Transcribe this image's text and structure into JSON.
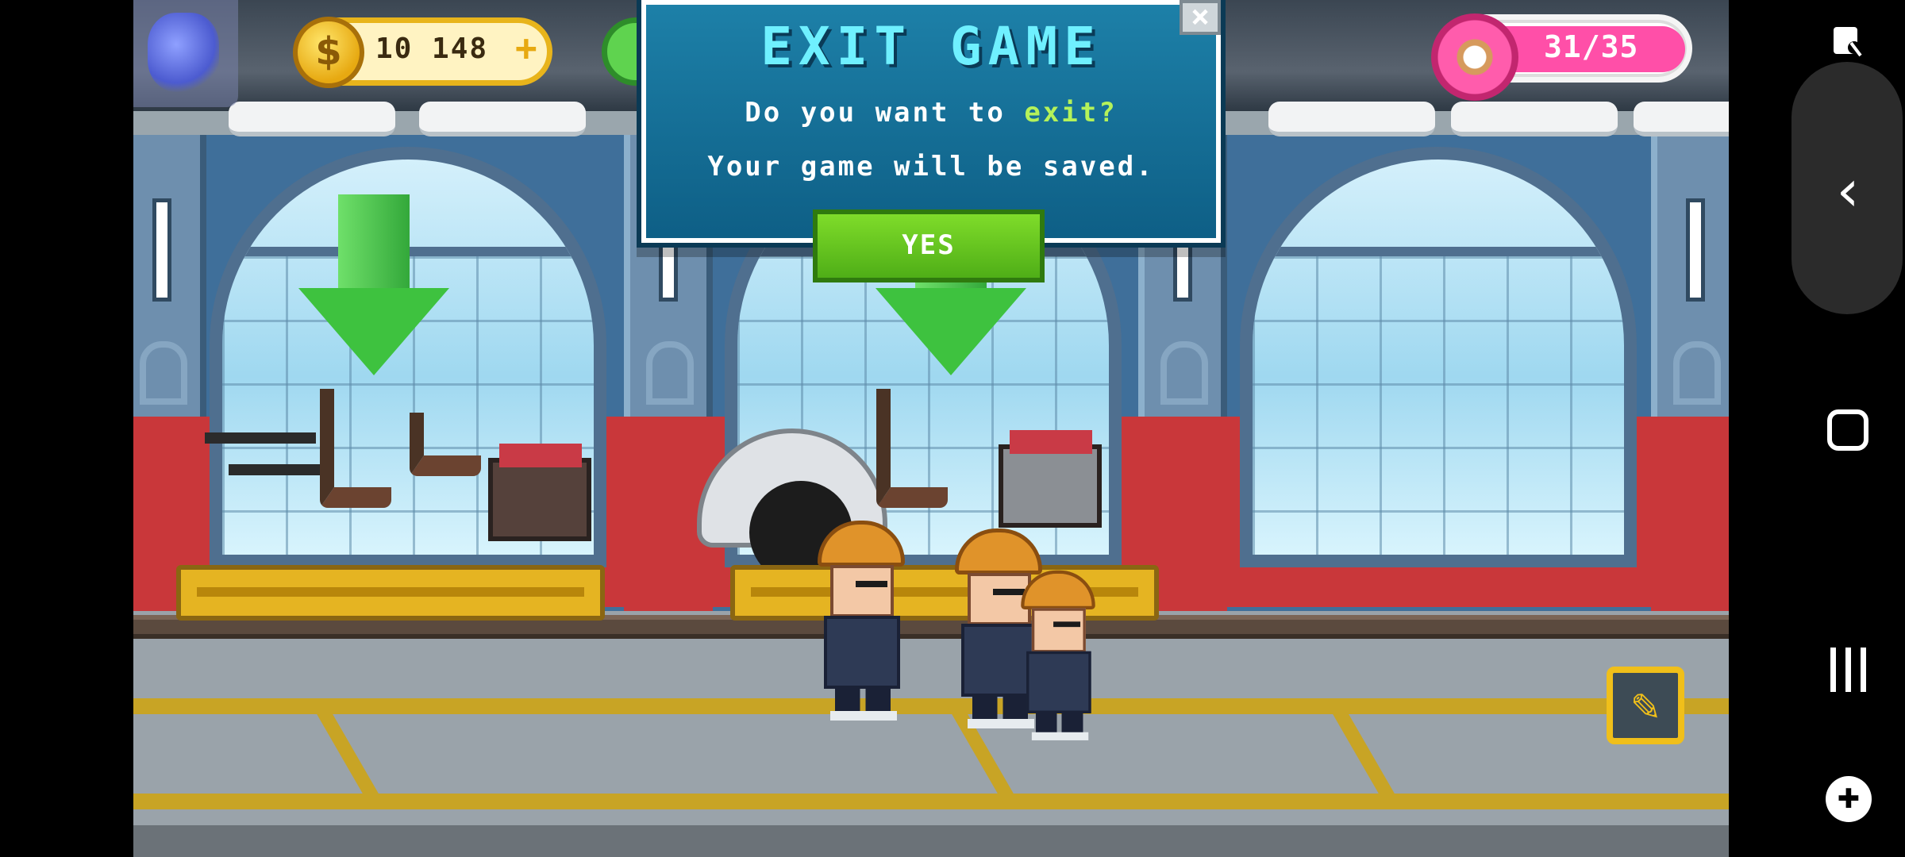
{
  "hud": {
    "coins": {
      "icon": "dollar-coin-icon",
      "symbol": "$",
      "value": "10 148",
      "add": "+"
    },
    "donuts": {
      "icon": "donut-icon",
      "value": "31/35",
      "fill_fraction": 0.89
    }
  },
  "dialog": {
    "title": "EXIT GAME",
    "line1_prefix": "Do you want to ",
    "line1_highlight": "exit?",
    "line2": "Your game will be saved.",
    "yes_label": "YES",
    "close_icon": "close-icon",
    "close_glyph": "×"
  },
  "tools_button": {
    "icon": "wrench-icon",
    "glyph": "🔧"
  },
  "colors": {
    "dialog_bg": "#0e5f86",
    "title": "#6ff0ff",
    "highlight": "#b4f25a",
    "yes_button": "#4fae17",
    "donut_bar": "#ff4fa8",
    "coin_border": "#e8b41b"
  },
  "nav": {
    "screenshot_icon": "screenshot-icon",
    "back_icon": "back-icon",
    "back_glyph": "‹",
    "home_icon": "home-icon",
    "recents_icon": "recents-icon",
    "game_tools_icon": "game-controller-icon",
    "game_glyph": "✚"
  }
}
